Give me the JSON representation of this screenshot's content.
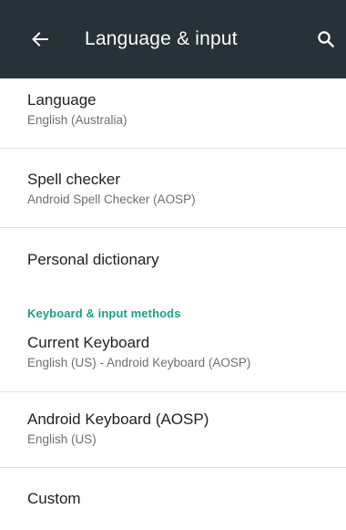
{
  "appbar": {
    "title": "Language & input",
    "back_icon": "back-arrow-icon",
    "search_icon": "search-icon",
    "background": "#263238"
  },
  "items": {
    "language": {
      "title": "Language",
      "summary": "English (Australia)"
    },
    "spell_checker": {
      "title": "Spell checker",
      "summary": "Android Spell Checker (AOSP)"
    },
    "personal_dictionary": {
      "title": "Personal dictionary"
    },
    "keyboard_section": {
      "header": "Keyboard & input methods",
      "color": "#1b9f8c"
    },
    "current_keyboard": {
      "title": "Current Keyboard",
      "summary": "English (US) - Android Keyboard (AOSP)"
    },
    "android_keyboard": {
      "title": "Android Keyboard (AOSP)",
      "summary": "English (US)"
    },
    "custom": {
      "title": "Custom"
    }
  }
}
